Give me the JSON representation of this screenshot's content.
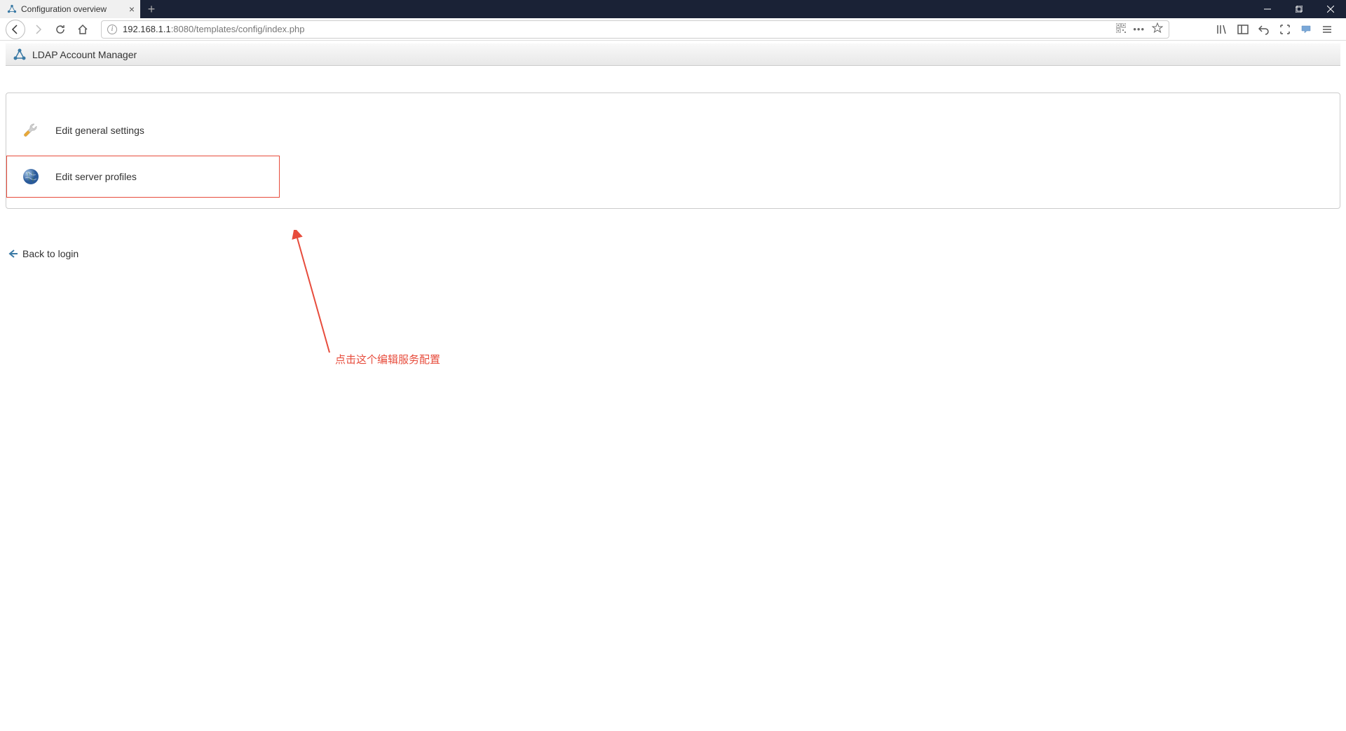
{
  "browser": {
    "tab_title": "Configuration overview",
    "url_host": "192.168.1.1",
    "url_rest": ":8080/templates/config/index.php"
  },
  "page": {
    "header_title": "LDAP Account Manager",
    "options": [
      {
        "label": "Edit general settings"
      },
      {
        "label": "Edit server profiles"
      }
    ],
    "back_link": "Back to login"
  },
  "annotation": {
    "text": "点击这个编辑服务配置"
  }
}
